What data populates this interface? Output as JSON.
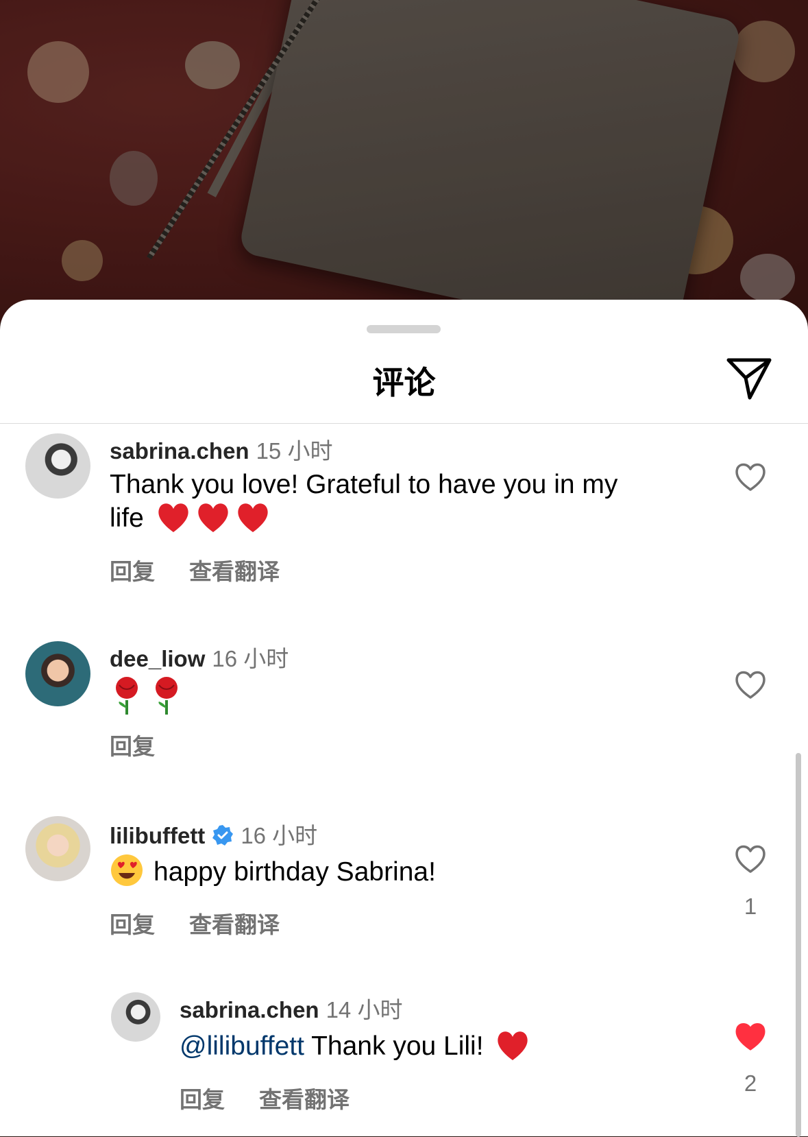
{
  "sheet": {
    "title": "评论"
  },
  "comments": [
    {
      "username": "sabrina.chen",
      "time": "15 小时",
      "text_line1": "Thank you love! Grateful to have you in my",
      "text_line2": "life",
      "emoji": "heart x3",
      "actions": [
        "回复",
        "查看翻译"
      ],
      "liked": false
    },
    {
      "username": "dee_liow",
      "time": "16 小时",
      "emoji": "rose x2",
      "actions": [
        "回复"
      ],
      "liked": false
    },
    {
      "username": "lilibuffett",
      "verified": true,
      "time": "16 小时",
      "text": "happy birthday Sabrina!",
      "emoji": "heart-eyes",
      "actions": [
        "回复",
        "查看翻译"
      ],
      "liked": false,
      "like_count": "1"
    },
    {
      "username": "sabrina.chen",
      "time": "14 小时",
      "mention": "@lilibuffett",
      "text": " Thank you Lili! ",
      "emoji": "heart",
      "actions": [
        "回复",
        "查看翻译"
      ],
      "liked": true,
      "like_count": "2",
      "is_reply": true
    }
  ],
  "colors": {
    "like_active": "#ff3040",
    "mention": "#00376b",
    "secondary_text": "#737373"
  },
  "icons": {
    "send": "paper-plane-icon",
    "like": "heart-outline-icon",
    "liked": "heart-filled-icon",
    "verified": "verified-badge-icon"
  }
}
